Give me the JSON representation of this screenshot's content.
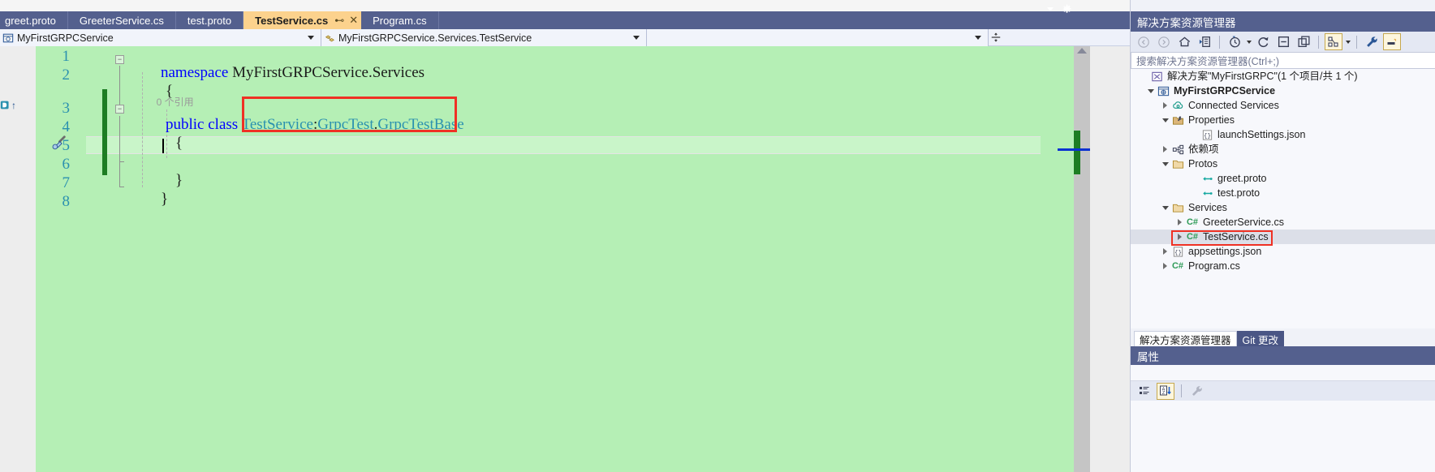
{
  "app": {
    "theme_accent": "#54608e",
    "tab_active_bg": "#fcd28d",
    "editor_bg": "#b5efb5",
    "highlight_box_color": "#ef3124"
  },
  "editor_tabs": {
    "items": [
      {
        "label": "greet.proto",
        "active": false
      },
      {
        "label": "GreeterService.cs",
        "active": false
      },
      {
        "label": "test.proto",
        "active": false
      },
      {
        "label": "TestService.cs",
        "active": true,
        "pin": "⊷",
        "close": "✕"
      },
      {
        "label": "Program.cs",
        "active": false
      }
    ],
    "overflow_caret": "▾",
    "settings_icon": "gear-icon"
  },
  "navbar": {
    "project": "MyFirstGRPCService",
    "member": "MyFirstGRPCService.Services.TestService",
    "blank": "",
    "project_icon": "project-icon",
    "member_icon": "class-icon",
    "split_icon": "split-window-icon"
  },
  "code": {
    "reference_hint": "0 个引用",
    "lines": [
      {
        "n": "1",
        "segments": [
          {
            "t": "namespace ",
            "c": "kw"
          },
          {
            "t": "MyFirstGRPCService.Services",
            "c": "plain"
          }
        ]
      },
      {
        "n": "2",
        "segments": [
          {
            "t": "{",
            "c": "plain"
          }
        ]
      },
      {
        "n": "3",
        "segments": [
          {
            "t": "public class ",
            "c": "kw"
          },
          {
            "t": "TestService",
            "c": "type"
          },
          {
            "t": ":",
            "c": "plain"
          },
          {
            "t": "GrpcTest",
            "c": "type"
          },
          {
            "t": ".",
            "c": "plain"
          },
          {
            "t": "GrpcTestBase",
            "c": "type"
          }
        ]
      },
      {
        "n": "4",
        "segments": [
          {
            "t": "{",
            "c": "plain"
          }
        ]
      },
      {
        "n": "5",
        "segments": [
          {
            "t": "",
            "c": "plain"
          }
        ]
      },
      {
        "n": "6",
        "segments": [
          {
            "t": "}",
            "c": "plain"
          }
        ]
      },
      {
        "n": "7",
        "segments": [
          {
            "t": "}",
            "c": "plain"
          }
        ]
      },
      {
        "n": "8",
        "segments": [
          {
            "t": "",
            "c": "plain"
          }
        ]
      }
    ],
    "quick_action_icon": "screwdriver-quick-actions-icon",
    "bookmark_icon": "bookmark-navigate-icon"
  },
  "solution_explorer": {
    "title": "解决方案资源管理器",
    "search_placeholder": "搜索解决方案资源管理器(Ctrl+;)",
    "toolbar": [
      {
        "name": "back-icon",
        "glyph": "◄",
        "framed": false
      },
      {
        "name": "forward-icon",
        "glyph": "►",
        "framed": false
      },
      {
        "name": "home-icon",
        "glyph": "⌂",
        "framed": false
      },
      {
        "name": "pending-changes-icon",
        "glyph": "▤",
        "framed": false
      },
      {
        "name": "separator",
        "glyph": "|",
        "framed": false
      },
      {
        "name": "history-icon",
        "glyph": "◷",
        "framed": false,
        "caret": true
      },
      {
        "name": "refresh-icon",
        "glyph": "⟳",
        "framed": false
      },
      {
        "name": "collapse-all-icon",
        "glyph": "⊟",
        "framed": false
      },
      {
        "name": "show-all-files-icon",
        "glyph": "❐",
        "framed": false
      },
      {
        "name": "separator",
        "glyph": "|",
        "framed": false
      },
      {
        "name": "view-class-diagram-icon",
        "glyph": "⦿",
        "framed": true,
        "caret": true
      },
      {
        "name": "separator",
        "glyph": "|",
        "framed": false
      },
      {
        "name": "properties-wrench-icon",
        "glyph": "🔧",
        "framed": false
      },
      {
        "name": "preview-selected-items-icon",
        "glyph": "▭",
        "framed": true
      }
    ],
    "tree": [
      {
        "id": "solution",
        "label": "解决方案\"MyFirstGRPC\"(1 个项目/共 1 个)",
        "indent": 0,
        "twisty": "none",
        "icon": "solution-icon",
        "bold": false,
        "selected": false
      },
      {
        "id": "project",
        "label": "MyFirstGRPCService",
        "indent": 1,
        "twisty": "down",
        "icon": "project-web-icon",
        "bold": true,
        "selected": false
      },
      {
        "id": "connected-services",
        "label": "Connected Services",
        "indent": 2,
        "twisty": "right",
        "icon": "connected-services-icon",
        "bold": false,
        "selected": false
      },
      {
        "id": "properties",
        "label": "Properties",
        "indent": 2,
        "twisty": "down",
        "icon": "properties-folder-icon",
        "bold": false,
        "selected": false
      },
      {
        "id": "launchsettings",
        "label": "launchSettings.json",
        "indent": 4,
        "twisty": "none",
        "icon": "json-icon",
        "bold": false,
        "selected": false
      },
      {
        "id": "dependencies",
        "label": "依赖项",
        "indent": 2,
        "twisty": "right",
        "icon": "dependencies-icon",
        "bold": false,
        "selected": false
      },
      {
        "id": "protos",
        "label": "Protos",
        "indent": 2,
        "twisty": "down",
        "icon": "folder-icon",
        "bold": false,
        "selected": false
      },
      {
        "id": "greet-proto",
        "label": "greet.proto",
        "indent": 4,
        "twisty": "none",
        "icon": "proto-icon",
        "bold": false,
        "selected": false
      },
      {
        "id": "test-proto",
        "label": "test.proto",
        "indent": 4,
        "twisty": "none",
        "icon": "proto-icon",
        "bold": false,
        "selected": false
      },
      {
        "id": "services",
        "label": "Services",
        "indent": 2,
        "twisty": "down",
        "icon": "folder-icon",
        "bold": false,
        "selected": false
      },
      {
        "id": "greeterservice-cs",
        "label": "GreeterService.cs",
        "indent": 3,
        "twisty": "right",
        "icon": "csharp-icon",
        "bold": false,
        "selected": false
      },
      {
        "id": "testservice-cs",
        "label": "TestService.cs",
        "indent": 3,
        "twisty": "right",
        "icon": "csharp-icon",
        "bold": false,
        "selected": true
      },
      {
        "id": "appsettings-json",
        "label": "appsettings.json",
        "indent": 2,
        "twisty": "right",
        "icon": "json-icon",
        "bold": false,
        "selected": false
      },
      {
        "id": "program-cs",
        "label": "Program.cs",
        "indent": 2,
        "twisty": "right",
        "icon": "csharp-icon",
        "bold": false,
        "selected": false
      }
    ],
    "bottom_tabs": [
      {
        "label": "解决方案资源管理器",
        "active": true
      },
      {
        "label": "Git 更改",
        "active": false
      }
    ]
  },
  "properties_panel": {
    "title": "属性",
    "toolbar": [
      {
        "name": "categorized-icon",
        "glyph": "▤",
        "framed": false
      },
      {
        "name": "alphabetical-sort-icon",
        "glyph": "A↓",
        "framed": true
      },
      {
        "name": "separator",
        "glyph": "|",
        "framed": false
      },
      {
        "name": "property-pages-wrench-icon",
        "glyph": "🔧",
        "framed": false
      }
    ]
  }
}
